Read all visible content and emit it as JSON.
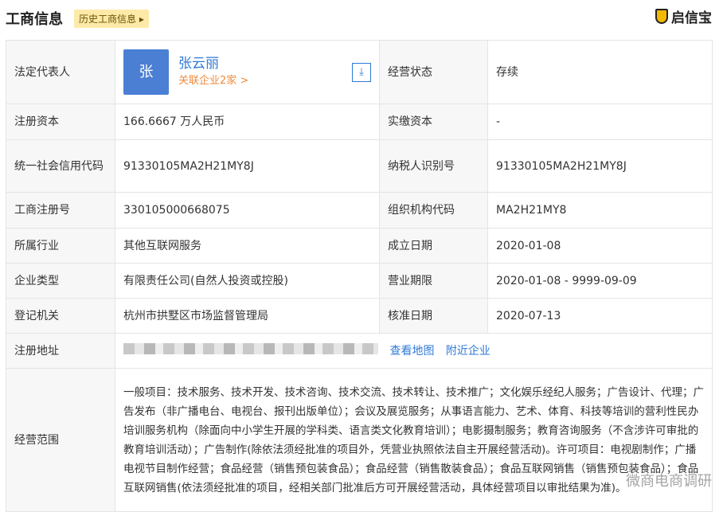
{
  "header": {
    "title": "工商信息",
    "history_button": "历史工商信息 ▸",
    "logo": "启信宝"
  },
  "legal_rep": {
    "label": "法定代表人",
    "avatar": "张",
    "name": "张云丽",
    "related": "关联企业2家 >",
    "download_icon": "download-icon"
  },
  "rows": [
    {
      "k1": "经营状态",
      "v1": "存续"
    },
    {
      "k1": "注册资本",
      "v1": "166.6667 万人民币",
      "k2": "实缴资本",
      "v2": "-"
    },
    {
      "k1": "统一社会信用代码",
      "v1": "91330105MA2H21MY8J",
      "k2": "纳税人识别号",
      "v2": "91330105MA2H21MY8J"
    },
    {
      "k1": "工商注册号",
      "v1": "330105000668075",
      "k2": "组织机构代码",
      "v2": "MA2H21MY8"
    },
    {
      "k1": "所属行业",
      "v1": "其他互联网服务",
      "k2": "成立日期",
      "v2": "2020-01-08"
    },
    {
      "k1": "企业类型",
      "v1": "有限责任公司(自然人投资或控股)",
      "k2": "营业期限",
      "v2": "2020-01-08 - 9999-09-09"
    },
    {
      "k1": "登记机关",
      "v1": "杭州市拱墅区市场监督管理局",
      "k2": "核准日期",
      "v2": "2020-07-13"
    }
  ],
  "address": {
    "label": "注册地址",
    "map_link": "查看地图",
    "nearby_link": "附近企业"
  },
  "scope": {
    "label": "经营范围",
    "text": "一般项目：技术服务、技术开发、技术咨询、技术交流、技术转让、技术推广；文化娱乐经纪人服务；广告设计、代理；广告发布（非广播电台、电视台、报刊出版单位）；会议及展览服务；从事语言能力、艺术、体育、科技等培训的营利性民办培训服务机构（除面向中小学生开展的学科类、语言类文化教育培训）；电影摄制服务；教育咨询服务（不含涉许可审批的教育培训活动）；广告制作(除依法须经批准的项目外，凭营业执照依法自主开展经营活动)。许可项目：电视剧制作；广播电视节目制作经营；食品经营（销售预包装食品）；食品经营（销售散装食品）；食品互联网销售（销售预包装食品）；食品互联网销售(依法须经批准的项目，经相关部门批准后方可开展经营活动，具体经营项目以审批结果为准)。"
  },
  "watermark": "微商电商调研"
}
